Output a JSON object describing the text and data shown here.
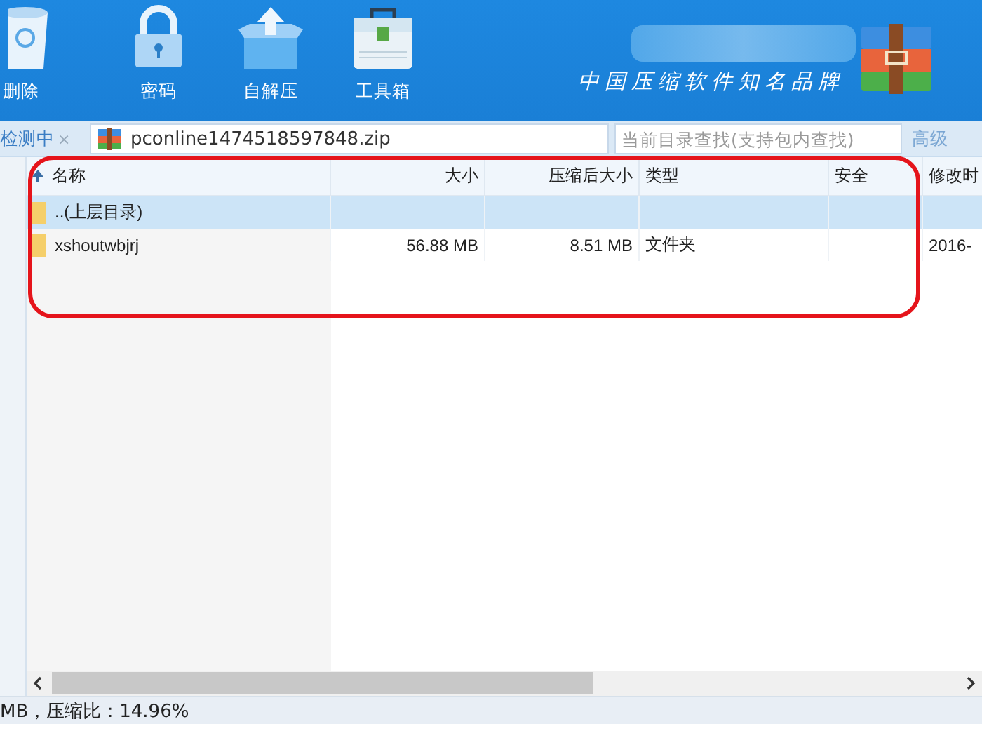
{
  "toolbar": {
    "buttons": [
      {
        "label": "删除",
        "kind": "trash"
      },
      {
        "label": "密码",
        "kind": "lock"
      },
      {
        "label": "自解压",
        "kind": "box"
      },
      {
        "label": "工具箱",
        "kind": "toolbox"
      }
    ],
    "slogan": "中国压缩软件知名品牌"
  },
  "tab": {
    "label": "检测中",
    "close": "×"
  },
  "address": {
    "path": "pconline1474518597848.zip"
  },
  "search": {
    "placeholder": "当前目录查找(支持包内查找)"
  },
  "advanced": "高级",
  "table": {
    "columns": [
      {
        "label": "名称",
        "sorted": true
      },
      {
        "label": "大小",
        "sorted": false
      },
      {
        "label": "压缩后大小",
        "sorted": false
      },
      {
        "label": "类型",
        "sorted": false
      },
      {
        "label": "安全",
        "sorted": false
      },
      {
        "label": "修改时",
        "sorted": false
      }
    ],
    "rows": [
      {
        "cells": [
          "..(上层目录)",
          "",
          "",
          "",
          "",
          ""
        ],
        "selected": true
      },
      {
        "cells": [
          "xshoutwbjrj",
          "56.88 MB",
          "8.51 MB",
          "文件夹",
          "",
          "2016-"
        ],
        "selected": false
      }
    ]
  },
  "status_bar": "MB，压缩比：14.96%"
}
